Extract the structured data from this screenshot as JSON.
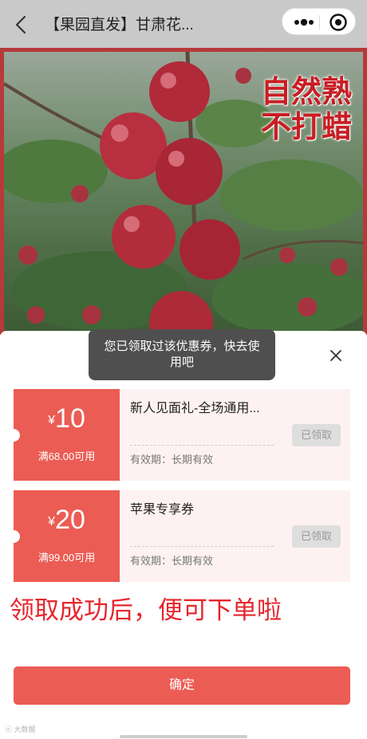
{
  "navbar": {
    "title": "【果园直发】甘肃花...",
    "colors": {
      "background": "#c9c9c9"
    }
  },
  "banner": {
    "slogan_line1": "自然熟",
    "slogan_line2": "不打蜡",
    "colors": {
      "frame": "#b63a3a",
      "slogan": "#c81e24"
    }
  },
  "toast": {
    "message": "您已领取过该优惠券，快去使用吧"
  },
  "coupons": [
    {
      "currency": "¥",
      "amount": "10",
      "condition": "满68.00可用",
      "name": "新人见面礼-全场通用...",
      "validity": "有效期：长期有效",
      "status": "已领取"
    },
    {
      "currency": "¥",
      "amount": "20",
      "condition": "满99.00可用",
      "name": "苹果专享券",
      "validity": "有效期：长期有效",
      "status": "已领取"
    }
  ],
  "note": "领取成功后，便可下单啦",
  "confirm_label": "确定",
  "watermark": "大数据",
  "colors": {
    "accent": "#eb5c54",
    "note": "#e5262d",
    "coupon_bg": "#fdf2f1"
  }
}
